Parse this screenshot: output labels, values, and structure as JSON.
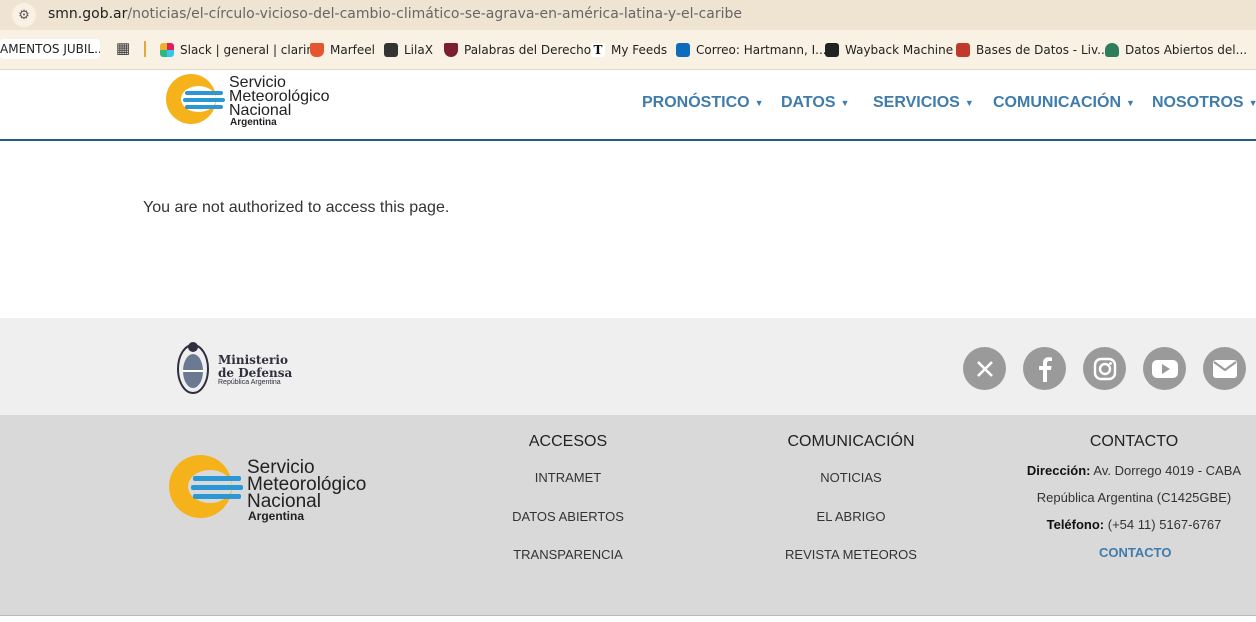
{
  "browser": {
    "url_host": "smn.gob.ar",
    "url_path": "/noticias/el-círculo-vicioso-del-cambio-climático-se-agrava-en-américa-latina-y-el-caribe",
    "bookmarks": [
      {
        "label": "AMENTOS JUBIL...",
        "icon": "folder-icon"
      },
      {
        "label": "Slack | general | clarin",
        "icon": "slack-icon",
        "color": "#e01e5a"
      },
      {
        "label": "Marfeel",
        "icon": "marfeel-icon",
        "color": "#e4572e"
      },
      {
        "label": "LilaX",
        "icon": "lilax-icon",
        "color": "#333333"
      },
      {
        "label": "Palabras del Derecho",
        "icon": "palabras-icon",
        "color": "#7a1f2b"
      },
      {
        "label": "My Feeds",
        "icon": "nyt-icon",
        "color": "#111111"
      },
      {
        "label": "Correo: Hartmann, I...",
        "icon": "outlook-icon",
        "color": "#0f6cbd"
      },
      {
        "label": "Wayback Machine",
        "icon": "wayback-icon",
        "color": "#222222"
      },
      {
        "label": "Bases de Datos - Liv...",
        "icon": "database-icon",
        "color": "#c0392b"
      },
      {
        "label": "Datos Abiertos del...",
        "icon": "datos-icon",
        "color": "#2e7d5b"
      }
    ]
  },
  "header": {
    "logo_line1": "Servicio",
    "logo_line2": "Meteorológico",
    "logo_line3": "Nacional",
    "logo_country": "Argentina",
    "nav": [
      {
        "label": "PRONÓSTICO"
      },
      {
        "label": "DATOS"
      },
      {
        "label": "SERVICIOS"
      },
      {
        "label": "COMUNICACIÓN"
      },
      {
        "label": "NOSOTROS"
      }
    ]
  },
  "main": {
    "message": "You are not authorized to access this page."
  },
  "footer": {
    "ministry_line1": "Ministerio",
    "ministry_line2": "de Defensa",
    "ministry_line3": "República Argentina",
    "social": [
      "x-icon",
      "facebook-icon",
      "instagram-icon",
      "youtube-icon",
      "email-icon"
    ],
    "logo_line1": "Servicio",
    "logo_line2": "Meteorológico",
    "logo_line3": "Nacional",
    "logo_country": "Argentina",
    "accesos": {
      "title": "ACCESOS",
      "links": [
        "INTRAMET",
        "DATOS ABIERTOS",
        "TRANSPARENCIA"
      ]
    },
    "comunicacion": {
      "title": "COMUNICACIÓN",
      "links": [
        "NOTICIAS",
        "EL ABRIGO",
        "REVISTA METEOROS"
      ]
    },
    "contacto": {
      "title": "CONTACTO",
      "address_label": "Dirección:",
      "address_value": "Av. Dorrego 4019 - CABA",
      "address_line2": "República Argentina (C1425GBE)",
      "phone_label": "Teléfono:",
      "phone_value": "(+54 11) 5167-6767",
      "link": "CONTACTO"
    }
  },
  "colors": {
    "brand_blue": "#3f7cac",
    "logo_yellow": "#f6b21b",
    "logo_blue": "#2b97d4"
  }
}
